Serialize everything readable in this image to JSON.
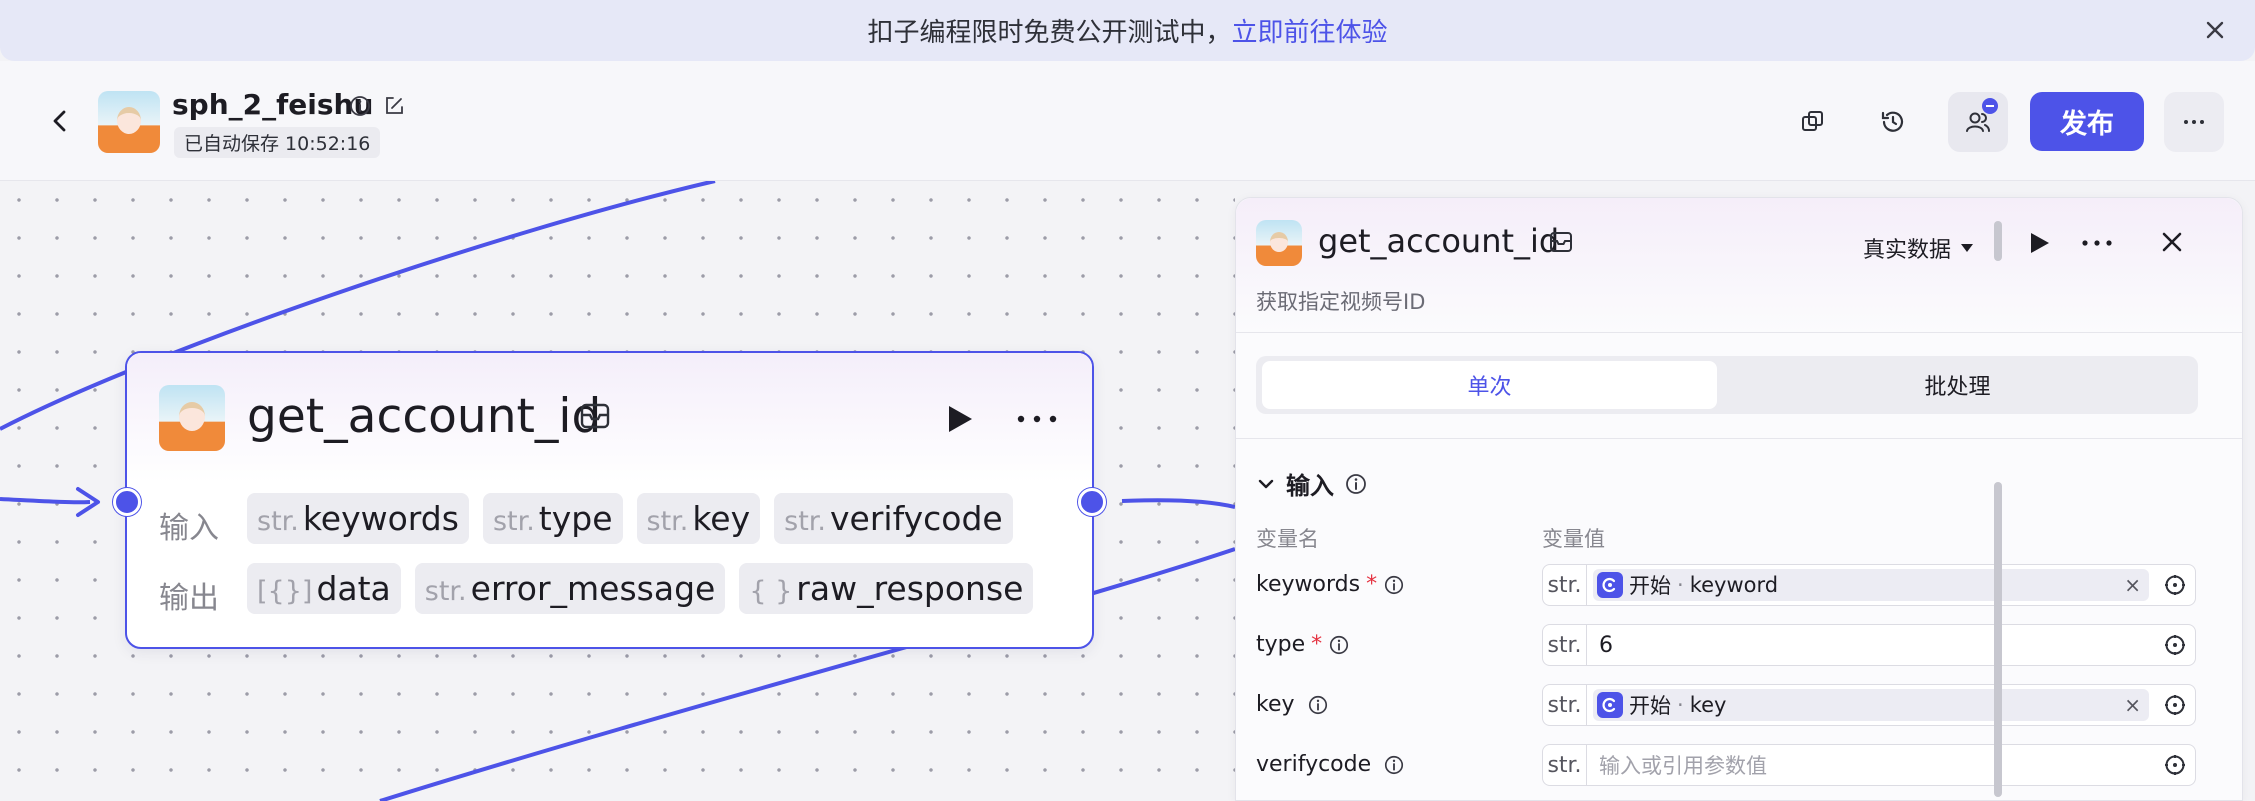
{
  "banner": {
    "text": "扣子编程限时免费公开测试中，",
    "link": "立即前往体验"
  },
  "header": {
    "app_name": "sph_2_feishu",
    "autosave": "已自动保存 10:52:16",
    "publish_label": "发布"
  },
  "node": {
    "title": "get_account_id",
    "input_label": "输入",
    "output_label": "输出",
    "inputs": [
      {
        "type": "str.",
        "name": "keywords"
      },
      {
        "type": "str.",
        "name": "type"
      },
      {
        "type": "str.",
        "name": "key"
      },
      {
        "type": "str.",
        "name": "verifycode"
      }
    ],
    "outputs": [
      {
        "type": "[{}]",
        "name": "data"
      },
      {
        "type": "str.",
        "name": "error_message"
      },
      {
        "type": "{ }",
        "name": "raw_response"
      }
    ]
  },
  "panel": {
    "title": "get_account_id",
    "description": "获取指定视频号ID",
    "data_mode": "真实数据",
    "tabs": [
      "单次",
      "批处理"
    ],
    "section_title": "输入",
    "col_name": "变量名",
    "col_value": "变量值",
    "params": [
      {
        "name": "keywords",
        "required": "*",
        "type": "str.",
        "ref_source": "开始",
        "ref_sep": "·",
        "ref_var": "keyword",
        "clear": "×"
      },
      {
        "name": "type",
        "required": "*",
        "type": "str.",
        "value": "6"
      },
      {
        "name": "key",
        "required": "",
        "type": "str.",
        "ref_source": "开始",
        "ref_sep": "·",
        "ref_var": "key",
        "clear": "×"
      },
      {
        "name": "verifycode",
        "required": "",
        "type": "str.",
        "placeholder": "输入或引用参数值"
      }
    ]
  },
  "colors": {
    "accent": "#4d53e8",
    "required": "#e53241"
  }
}
